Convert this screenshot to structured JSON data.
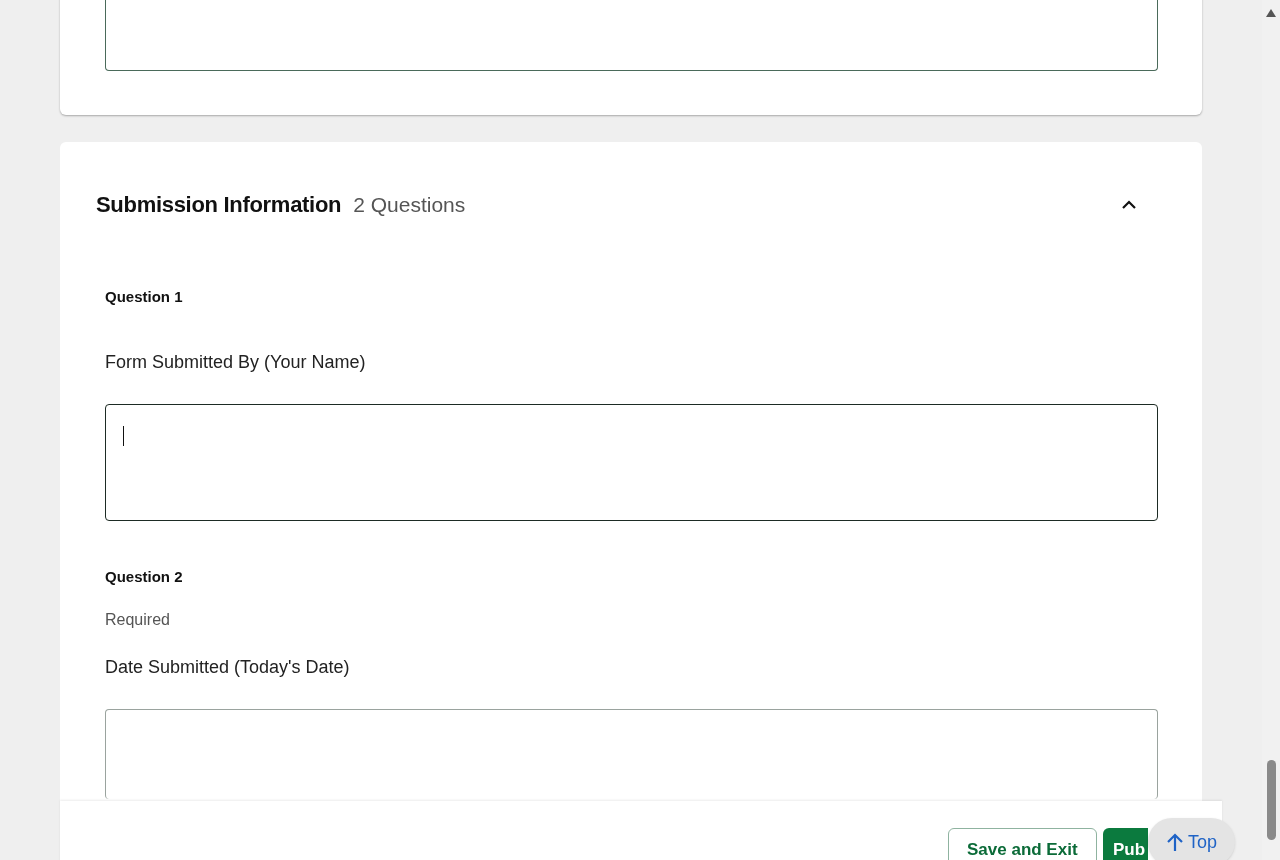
{
  "section": {
    "title": "Submission Information",
    "count": "2 Questions",
    "expanded": true
  },
  "questions": [
    {
      "number": "Question 1",
      "label": "Form Submitted By (Your Name)",
      "focused": true
    },
    {
      "number": "Question 2",
      "note": "Required",
      "label": "Date Submitted (Today's Date)",
      "focused": false
    }
  ],
  "actions": [
    "Save and Exit",
    "Pub"
  ],
  "top_button": "Top"
}
